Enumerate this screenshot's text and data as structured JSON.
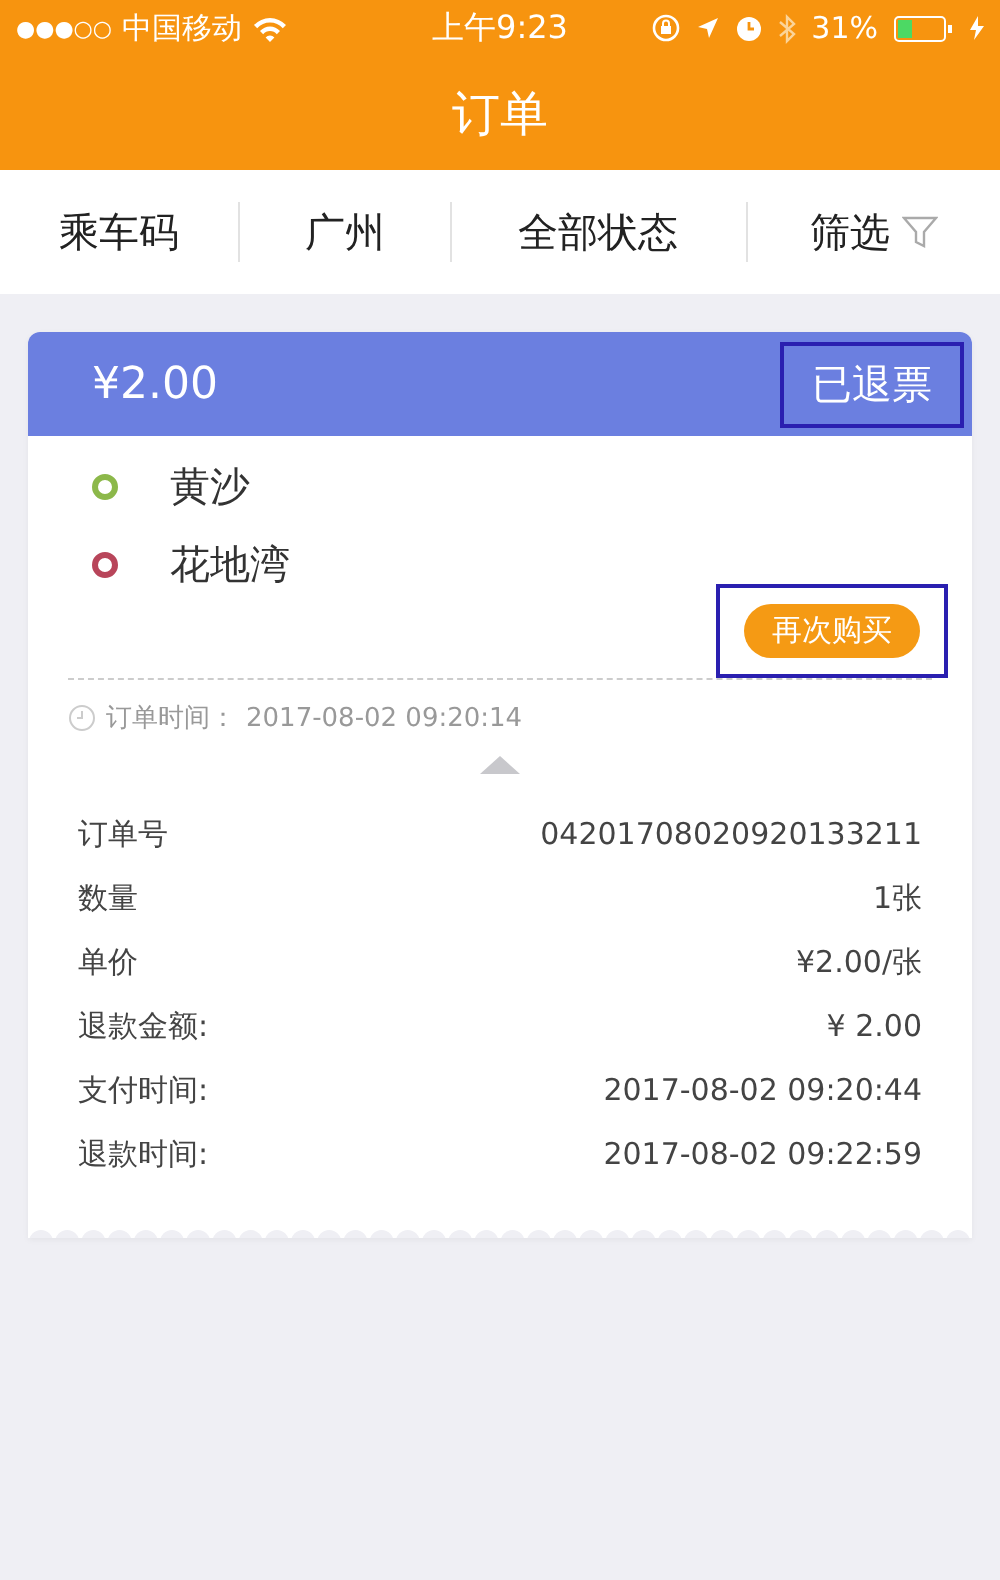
{
  "status_bar": {
    "signal": "●●●○○",
    "carrier": "中国移动",
    "time": "上午9:23",
    "battery": "31%"
  },
  "title": "订单",
  "filters": [
    {
      "label": "乘车码",
      "kind": "plain"
    },
    {
      "label": "广州",
      "kind": "plain"
    },
    {
      "label": "全部状态",
      "kind": "plain"
    },
    {
      "label": "筛选",
      "kind": "filter"
    }
  ],
  "order": {
    "amount": "¥2.00",
    "status": {
      "text": "已退票",
      "highlighted": true
    },
    "stations": [
      {
        "name": "黄沙",
        "color": "#8cb84a"
      },
      {
        "name": "花地湾",
        "color": "#b8455a"
      }
    ],
    "action": {
      "label": "再次购买",
      "highlighted": true
    },
    "order_time": {
      "label": "订单时间：",
      "value": "2017-08-02 09:20:14"
    },
    "details": [
      {
        "label": "订单号",
        "value": "04201708020920133211"
      },
      {
        "label": "数量",
        "value": "1张"
      },
      {
        "label": "单价",
        "value": "¥2.00/张"
      },
      {
        "label": "退款金额:",
        "value": "¥ 2.00"
      },
      {
        "label": "支付时间:",
        "value": "2017-08-02 09:20:44"
      },
      {
        "label": "退款时间:",
        "value": "2017-08-02 09:22:59"
      }
    ]
  }
}
